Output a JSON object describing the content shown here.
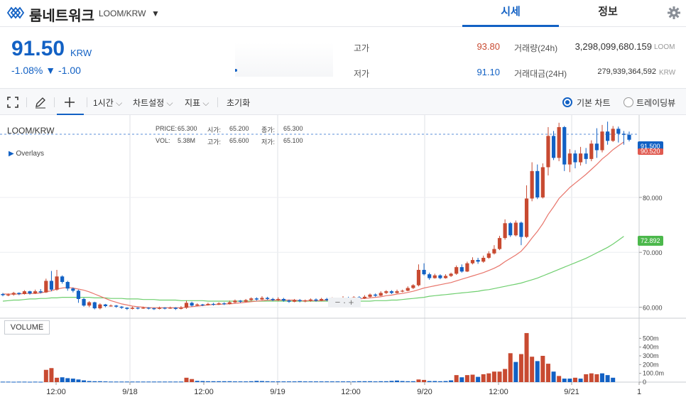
{
  "header": {
    "coin_name": "룸네트워크",
    "pair": "LOOM/KRW",
    "tabs": [
      "시세",
      "정보"
    ]
  },
  "summary": {
    "price": "91.50",
    "unit": "KRW",
    "change": "-1.08% ▼ -1.00",
    "high_label": "고가",
    "high_value": "93.80",
    "low_label": "저가",
    "low_value": "91.10",
    "volume_label": "거래량(24h)",
    "volume_value": "3,298,099,680.159",
    "volume_unit": "LOOM",
    "amount_label": "거래대금(24H)",
    "amount_value": "279,939,364,592",
    "amount_unit": "KRW"
  },
  "toolbar": {
    "interval": "1시간",
    "chart_settings": "차트설정",
    "indicators": "지표",
    "reset": "초기화",
    "basic_chart": "기본 차트",
    "tradingview": "트레이딩뷰"
  },
  "chart_legend": {
    "symbol": "LOOM/KRW",
    "overlays": "Overlays",
    "price_lbl": "PRICE:",
    "price_val": "65.300",
    "open_lbl": "시가:",
    "open_val": "65.200",
    "close_lbl": "종가:",
    "close_val": "65.300",
    "vol_lbl": "VOL:",
    "vol_val": "5.38M",
    "high_lbl": "고가:",
    "high_val": "65.600",
    "low_lbl": "저가:",
    "low_val": "65.100",
    "volume_panel": "VOLUME"
  },
  "colors": {
    "up": "#c84a31",
    "down": "#1261c4",
    "ma_short": "#e8756b",
    "ma_long": "#6fcf6f",
    "accent": "#1261c4"
  },
  "chart_data": {
    "type": "candlestick",
    "x_tick_labels": [
      "12:00",
      "9/18",
      "12:00",
      "9/19",
      "12:00",
      "9/20",
      "12:00",
      "9/21",
      "1"
    ],
    "y_tick_labels": [
      "80.000",
      "70.000",
      "60.000"
    ],
    "volume_tick_labels": [
      "500m",
      "400m",
      "300m",
      "200m",
      "100.0m",
      "0"
    ],
    "current_price_tag": "91.500",
    "ma_tag_short": "90.520",
    "ma_tag_long": "72.892",
    "ylim": [
      58,
      95
    ],
    "volume_ylim": [
      0,
      600
    ],
    "candles": [
      [
        62.4,
        62.2,
        62.6,
        62.0
      ],
      [
        62.2,
        62.3,
        62.5,
        62.0
      ],
      [
        62.3,
        62.6,
        62.8,
        62.1
      ],
      [
        62.6,
        62.4,
        62.7,
        62.2
      ],
      [
        62.4,
        62.9,
        63.1,
        62.3
      ],
      [
        62.9,
        62.5,
        63.0,
        62.3
      ],
      [
        62.5,
        62.9,
        63.2,
        62.4
      ],
      [
        62.9,
        62.7,
        63.3,
        62.5
      ],
      [
        62.7,
        64.8,
        65.2,
        62.6
      ],
      [
        64.8,
        63.2,
        66.6,
        62.9
      ],
      [
        63.2,
        65.6,
        66.8,
        63.0
      ],
      [
        65.6,
        64.6,
        65.8,
        64.3
      ],
      [
        64.6,
        63.4,
        64.8,
        63.0
      ],
      [
        63.4,
        63.0,
        63.6,
        62.7
      ],
      [
        63.0,
        61.5,
        63.2,
        60.8
      ],
      [
        61.5,
        60.3,
        61.7,
        60.1
      ],
      [
        60.3,
        60.9,
        61.1,
        60.0
      ],
      [
        60.9,
        59.8,
        61.0,
        59.6
      ],
      [
        59.8,
        60.5,
        60.7,
        59.6
      ],
      [
        60.5,
        60.2,
        60.6,
        60.0
      ],
      [
        60.2,
        60.3,
        60.5,
        60.1
      ],
      [
        60.3,
        60.1,
        60.4,
        59.9
      ],
      [
        60.1,
        59.9,
        60.2,
        59.7
      ],
      [
        59.9,
        59.7,
        60.0,
        59.5
      ],
      [
        59.7,
        59.9,
        60.1,
        59.6
      ],
      [
        59.9,
        59.8,
        60.0,
        59.6
      ],
      [
        59.8,
        59.9,
        60.1,
        59.7
      ],
      [
        59.9,
        59.8,
        60.0,
        59.6
      ],
      [
        59.8,
        59.7,
        59.9,
        59.5
      ],
      [
        59.7,
        59.9,
        60.1,
        59.6
      ],
      [
        59.9,
        59.8,
        60.0,
        59.6
      ],
      [
        59.8,
        59.9,
        60.1,
        59.7
      ],
      [
        59.9,
        59.7,
        60.0,
        59.5
      ],
      [
        59.7,
        59.9,
        60.2,
        59.6
      ],
      [
        59.9,
        60.8,
        61.2,
        59.7
      ],
      [
        60.8,
        60.3,
        61.0,
        60.1
      ],
      [
        60.3,
        60.5,
        60.7,
        60.2
      ],
      [
        60.5,
        60.4,
        60.6,
        60.2
      ],
      [
        60.4,
        60.6,
        60.8,
        60.3
      ],
      [
        60.6,
        60.5,
        60.8,
        60.3
      ],
      [
        60.5,
        60.7,
        60.9,
        60.4
      ],
      [
        60.7,
        60.6,
        60.9,
        60.4
      ],
      [
        60.6,
        60.9,
        61.2,
        60.5
      ],
      [
        60.9,
        61.2,
        61.4,
        60.7
      ],
      [
        61.2,
        61.0,
        61.3,
        60.8
      ],
      [
        61.0,
        61.3,
        61.5,
        60.9
      ],
      [
        61.3,
        61.6,
        61.8,
        61.1
      ],
      [
        61.6,
        61.4,
        61.8,
        61.2
      ],
      [
        61.4,
        61.7,
        62.0,
        61.3
      ],
      [
        61.7,
        61.5,
        61.9,
        61.3
      ],
      [
        61.5,
        61.3,
        61.7,
        61.1
      ],
      [
        61.3,
        61.5,
        61.8,
        61.1
      ],
      [
        61.5,
        61.2,
        61.7,
        61.0
      ],
      [
        61.2,
        61.0,
        61.4,
        60.8
      ],
      [
        61.0,
        61.3,
        61.5,
        60.9
      ],
      [
        61.3,
        61.1,
        61.5,
        60.9
      ],
      [
        61.1,
        61.2,
        61.4,
        60.9
      ],
      [
        61.2,
        61.4,
        61.6,
        61.0
      ],
      [
        61.4,
        61.2,
        61.6,
        61.0
      ],
      [
        61.2,
        61.5,
        61.7,
        61.1
      ],
      [
        61.5,
        61.3,
        61.7,
        61.1
      ],
      [
        61.3,
        61.5,
        61.8,
        61.2
      ],
      [
        61.5,
        61.4,
        61.7,
        61.2
      ],
      [
        61.4,
        61.7,
        62.0,
        61.3
      ],
      [
        61.7,
        61.5,
        61.9,
        61.3
      ],
      [
        61.5,
        61.8,
        62.0,
        61.4
      ],
      [
        61.8,
        61.6,
        62.0,
        61.4
      ],
      [
        61.6,
        61.9,
        62.2,
        61.5
      ],
      [
        61.9,
        62.3,
        62.5,
        61.7
      ],
      [
        62.3,
        62.1,
        62.5,
        61.9
      ],
      [
        62.1,
        62.6,
        62.9,
        62.0
      ],
      [
        62.6,
        62.9,
        63.1,
        62.4
      ],
      [
        62.9,
        62.6,
        63.1,
        62.4
      ],
      [
        62.6,
        62.9,
        63.2,
        62.5
      ],
      [
        62.9,
        63.0,
        63.2,
        62.7
      ],
      [
        63.0,
        63.5,
        63.8,
        62.9
      ],
      [
        63.5,
        64.0,
        64.2,
        63.3
      ],
      [
        64.0,
        66.8,
        67.8,
        63.8
      ],
      [
        66.8,
        66.0,
        68.0,
        65.8
      ],
      [
        66.0,
        65.3,
        66.3,
        65.0
      ],
      [
        65.3,
        65.8,
        66.1,
        65.2
      ],
      [
        65.8,
        65.3,
        66.0,
        65.1
      ],
      [
        65.3,
        65.7,
        66.0,
        65.2
      ],
      [
        65.7,
        66.1,
        66.3,
        65.5
      ],
      [
        66.1,
        67.3,
        67.6,
        65.9
      ],
      [
        67.3,
        66.5,
        67.8,
        66.3
      ],
      [
        66.5,
        68.0,
        68.3,
        66.4
      ],
      [
        68.0,
        68.6,
        69.1,
        67.8
      ],
      [
        68.6,
        68.3,
        69.0,
        67.9
      ],
      [
        68.3,
        69.0,
        69.4,
        68.1
      ],
      [
        69.0,
        69.8,
        70.2,
        68.8
      ],
      [
        69.8,
        70.6,
        71.3,
        69.6
      ],
      [
        70.6,
        72.6,
        73.0,
        70.4
      ],
      [
        72.6,
        75.3,
        76.0,
        72.3
      ],
      [
        75.3,
        73.1,
        75.5,
        72.8
      ],
      [
        73.1,
        75.4,
        75.8,
        72.9
      ],
      [
        75.4,
        72.8,
        75.6,
        71.3
      ],
      [
        72.8,
        79.8,
        82.2,
        72.6
      ],
      [
        79.8,
        84.8,
        86.4,
        79.3
      ],
      [
        84.8,
        80.0,
        86.0,
        79.7
      ],
      [
        80.0,
        85.5,
        86.2,
        79.8
      ],
      [
        85.5,
        91.2,
        92.8,
        84.0
      ],
      [
        91.2,
        87.2,
        92.1,
        86.8
      ],
      [
        87.2,
        92.8,
        93.6,
        86.6
      ],
      [
        92.8,
        86.0,
        93.0,
        84.8
      ],
      [
        86.0,
        88.0,
        88.8,
        84.6
      ],
      [
        88.0,
        86.4,
        88.6,
        85.3
      ],
      [
        86.4,
        88.0,
        89.2,
        85.8
      ],
      [
        88.0,
        87.0,
        89.0,
        86.1
      ],
      [
        87.0,
        89.8,
        90.4,
        86.6
      ],
      [
        89.8,
        88.6,
        92.6,
        87.2
      ],
      [
        88.6,
        92.0,
        93.2,
        88.2
      ],
      [
        92.0,
        90.3,
        93.8,
        89.6
      ],
      [
        90.3,
        92.5,
        93.0,
        90.1
      ],
      [
        92.5,
        91.6,
        92.9,
        90.0
      ],
      [
        91.6,
        91.4,
        92.1,
        89.6
      ],
      [
        91.4,
        90.5,
        92.0,
        90.2
      ]
    ],
    "volumes": [
      [
        5,
        "d"
      ],
      [
        5,
        "d"
      ],
      [
        4,
        "d"
      ],
      [
        5,
        "d"
      ],
      [
        5,
        "d"
      ],
      [
        4,
        "d"
      ],
      [
        5,
        "d"
      ],
      [
        4,
        "d"
      ],
      [
        140,
        "u"
      ],
      [
        160,
        "u"
      ],
      [
        50,
        "u"
      ],
      [
        55,
        "d"
      ],
      [
        45,
        "d"
      ],
      [
        40,
        "d"
      ],
      [
        30,
        "d"
      ],
      [
        20,
        "d"
      ],
      [
        12,
        "d"
      ],
      [
        10,
        "d"
      ],
      [
        10,
        "d"
      ],
      [
        8,
        "d"
      ],
      [
        6,
        "d"
      ],
      [
        6,
        "d"
      ],
      [
        6,
        "d"
      ],
      [
        6,
        "d"
      ],
      [
        6,
        "d"
      ],
      [
        6,
        "d"
      ],
      [
        6,
        "d"
      ],
      [
        6,
        "d"
      ],
      [
        6,
        "d"
      ],
      [
        6,
        "d"
      ],
      [
        6,
        "d"
      ],
      [
        6,
        "d"
      ],
      [
        6,
        "d"
      ],
      [
        6,
        "d"
      ],
      [
        50,
        "u"
      ],
      [
        35,
        "u"
      ],
      [
        14,
        "d"
      ],
      [
        12,
        "d"
      ],
      [
        10,
        "d"
      ],
      [
        10,
        "d"
      ],
      [
        10,
        "d"
      ],
      [
        10,
        "d"
      ],
      [
        10,
        "d"
      ],
      [
        8,
        "d"
      ],
      [
        8,
        "d"
      ],
      [
        8,
        "d"
      ],
      [
        10,
        "d"
      ],
      [
        14,
        "d"
      ],
      [
        12,
        "d"
      ],
      [
        10,
        "d"
      ],
      [
        8,
        "d"
      ],
      [
        8,
        "d"
      ],
      [
        8,
        "d"
      ],
      [
        8,
        "d"
      ],
      [
        8,
        "d"
      ],
      [
        10,
        "d"
      ],
      [
        8,
        "d"
      ],
      [
        8,
        "d"
      ],
      [
        8,
        "d"
      ],
      [
        8,
        "d"
      ],
      [
        8,
        "d"
      ],
      [
        8,
        "d"
      ],
      [
        8,
        "d"
      ],
      [
        8,
        "d"
      ],
      [
        8,
        "d"
      ],
      [
        8,
        "d"
      ],
      [
        10,
        "d"
      ],
      [
        10,
        "d"
      ],
      [
        10,
        "d"
      ],
      [
        8,
        "d"
      ],
      [
        10,
        "d"
      ],
      [
        10,
        "d"
      ],
      [
        14,
        "d"
      ],
      [
        18,
        "d"
      ],
      [
        12,
        "d"
      ],
      [
        10,
        "d"
      ],
      [
        10,
        "d"
      ],
      [
        30,
        "u"
      ],
      [
        25,
        "u"
      ],
      [
        12,
        "d"
      ],
      [
        12,
        "d"
      ],
      [
        10,
        "d"
      ],
      [
        12,
        "d"
      ],
      [
        20,
        "d"
      ],
      [
        80,
        "u"
      ],
      [
        55,
        "d"
      ],
      [
        80,
        "u"
      ],
      [
        85,
        "u"
      ],
      [
        60,
        "d"
      ],
      [
        90,
        "u"
      ],
      [
        100,
        "u"
      ],
      [
        120,
        "u"
      ],
      [
        120,
        "u"
      ],
      [
        150,
        "u"
      ],
      [
        330,
        "u"
      ],
      [
        230,
        "d"
      ],
      [
        320,
        "u"
      ],
      [
        560,
        "u"
      ],
      [
        290,
        "u"
      ],
      [
        240,
        "d"
      ],
      [
        300,
        "u"
      ],
      [
        210,
        "u"
      ],
      [
        120,
        "d"
      ],
      [
        70,
        "u"
      ],
      [
        40,
        "d"
      ],
      [
        40,
        "d"
      ],
      [
        50,
        "u"
      ],
      [
        40,
        "d"
      ],
      [
        90,
        "u"
      ],
      [
        100,
        "u"
      ],
      [
        90,
        "u"
      ],
      [
        100,
        "d"
      ],
      [
        80,
        "d"
      ],
      [
        50,
        "d"
      ]
    ],
    "ma_short": [
      62.4,
      62.4,
      62.4,
      62.4,
      62.5,
      62.5,
      62.5,
      62.6,
      62.8,
      63.0,
      63.3,
      63.5,
      63.6,
      63.5,
      63.3,
      63.1,
      62.8,
      62.4,
      62.0,
      61.6,
      61.2,
      60.9,
      60.6,
      60.4,
      60.2,
      60.1,
      60.0,
      59.9,
      59.9,
      59.9,
      59.9,
      59.9,
      59.9,
      59.9,
      60.0,
      60.1,
      60.2,
      60.3,
      60.4,
      60.5,
      60.5,
      60.6,
      60.6,
      60.7,
      60.8,
      60.9,
      61.0,
      61.1,
      61.2,
      61.3,
      61.3,
      61.3,
      61.3,
      61.3,
      61.3,
      61.2,
      61.2,
      61.2,
      61.2,
      61.2,
      61.3,
      61.3,
      61.3,
      61.4,
      61.4,
      61.5,
      61.5,
      61.6,
      61.7,
      61.8,
      61.9,
      62.1,
      62.2,
      62.4,
      62.5,
      62.7,
      62.9,
      63.2,
      63.5,
      63.7,
      63.9,
      64.1,
      64.3,
      64.5,
      64.8,
      65.1,
      65.4,
      65.7,
      66.0,
      66.3,
      66.7,
      67.1,
      67.6,
      68.3,
      68.9,
      69.5,
      70.2,
      71.3,
      72.6,
      73.8,
      75.2,
      76.9,
      78.3,
      79.8,
      80.8,
      81.8,
      82.6,
      83.4,
      84.2,
      85.1,
      86.0,
      87.0,
      87.8,
      88.7,
      89.4,
      90.1
    ],
    "ma_long": [
      61.1,
      61.2,
      61.3,
      61.3,
      61.4,
      61.5,
      61.5,
      61.6,
      61.6,
      61.7,
      61.7,
      61.8,
      61.8,
      61.8,
      61.8,
      61.8,
      61.8,
      61.7,
      61.7,
      61.7,
      61.6,
      61.6,
      61.6,
      61.5,
      61.5,
      61.5,
      61.4,
      61.4,
      61.4,
      61.3,
      61.3,
      61.3,
      61.3,
      61.2,
      61.2,
      61.2,
      61.2,
      61.2,
      61.1,
      61.1,
      61.1,
      61.1,
      61.1,
      61.1,
      61.1,
      61.1,
      61.1,
      61.1,
      61.1,
      61.1,
      61.1,
      61.1,
      61.1,
      61.1,
      61.1,
      61.1,
      61.1,
      61.1,
      61.1,
      61.1,
      61.1,
      61.1,
      61.1,
      61.1,
      61.1,
      61.1,
      61.1,
      61.1,
      61.1,
      61.2,
      61.2,
      61.2,
      61.3,
      61.3,
      61.4,
      61.5,
      61.6,
      61.7,
      61.8,
      62.0,
      62.1,
      62.2,
      62.3,
      62.4,
      62.5,
      62.6,
      62.7,
      62.8,
      62.9,
      63.1,
      63.2,
      63.4,
      63.6,
      63.8,
      64.0,
      64.2,
      64.4,
      64.7,
      65.0,
      65.3,
      65.7,
      66.1,
      66.5,
      66.9,
      67.3,
      67.7,
      68.1,
      68.5,
      68.9,
      69.4,
      69.9,
      70.4,
      70.9,
      71.5,
      72.2,
      72.9
    ]
  }
}
